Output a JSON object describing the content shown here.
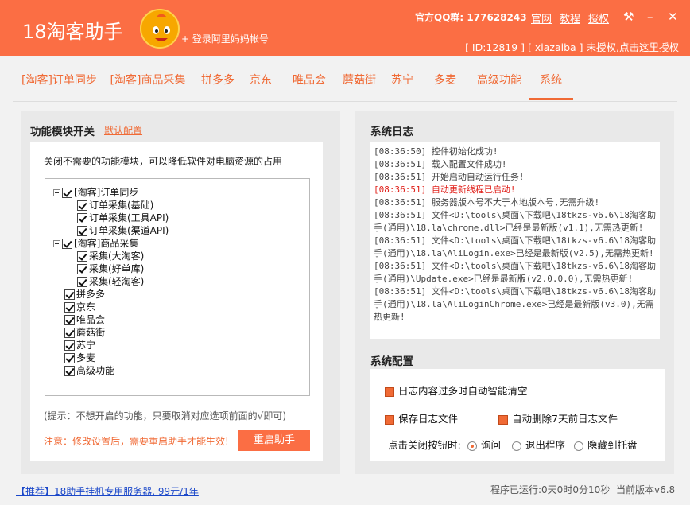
{
  "header": {
    "app_title": "18淘客助手",
    "login_link": "+ 登录阿里妈妈帐号",
    "qq_group_label": "官方QQ群:",
    "qq_group_number": "177628243",
    "links": [
      "官网",
      "教程",
      "授权"
    ],
    "user_info": "[ ID:12819 ] [ xiazaiba ] 未授权,点击这里授权",
    "colors": {
      "bar": "#fb6e44",
      "accent": "#f06a35"
    }
  },
  "tabs": [
    {
      "label": "[淘客]订单同步"
    },
    {
      "label": "[淘客]商品采集"
    },
    {
      "label": "拼多多"
    },
    {
      "label": "京东"
    },
    {
      "label": "唯品会"
    },
    {
      "label": "蘑菇街"
    },
    {
      "label": "苏宁"
    },
    {
      "label": "多麦"
    },
    {
      "label": "高级功能"
    },
    {
      "label": "系统",
      "active": true
    }
  ],
  "modules": {
    "title": "功能模块开关",
    "default_link": "默认配置",
    "description": "关闭不需要的功能模块，可以降低软件对电脑资源的占用",
    "tree": [
      {
        "label": "[淘客]订单同步",
        "level": 0,
        "expanded": true,
        "checked": true
      },
      {
        "label": "订单采集(基础)",
        "level": 1,
        "checked": true
      },
      {
        "label": "订单采集(工具API)",
        "level": 1,
        "checked": true
      },
      {
        "label": "订单采集(渠道API)",
        "level": 1,
        "checked": true
      },
      {
        "label": "[淘客]商品采集",
        "level": 0,
        "expanded": true,
        "checked": true
      },
      {
        "label": "采集(大淘客)",
        "level": 1,
        "checked": true
      },
      {
        "label": "采集(好单库)",
        "level": 1,
        "checked": true
      },
      {
        "label": "采集(轻淘客)",
        "level": 1,
        "checked": true
      },
      {
        "label": "拼多多",
        "level": 0,
        "checked": true
      },
      {
        "label": "京东",
        "level": 0,
        "checked": true
      },
      {
        "label": "唯品会",
        "level": 0,
        "checked": true
      },
      {
        "label": "蘑菇街",
        "level": 0,
        "checked": true
      },
      {
        "label": "苏宁",
        "level": 0,
        "checked": true
      },
      {
        "label": "多麦",
        "level": 0,
        "checked": true
      },
      {
        "label": "高级功能",
        "level": 0,
        "checked": true
      }
    ],
    "hint": "(提示：不想开启的功能，只要取消对应选项前面的√即可)",
    "notice": "注意：修改设置后，需要重启助手才能生效!",
    "restart_label": "重启助手"
  },
  "syslog": {
    "title": "系统日志",
    "lines": [
      {
        "text": "[08:36:50] 控件初始化成功!"
      },
      {
        "text": "[08:36:51] 载入配置文件成功!"
      },
      {
        "text": "[08:36:51] 开始启动自动运行任务!"
      },
      {
        "text": "[08:36:51] 自动更新线程已启动!",
        "error": true
      },
      {
        "text": "[08:36:51] 服务器版本号不大于本地版本号,无需升级!"
      },
      {
        "text": "[08:36:51] 文件<D:\\tools\\桌面\\下载吧\\18tkzs-v6.6\\18淘客助"
      },
      {
        "text": "手(通用)\\18.la\\chrome.dll>已经是最新版(v1.1),无需热更新!"
      },
      {
        "text": "[08:36:51] 文件<D:\\tools\\桌面\\下载吧\\18tkzs-v6.6\\18淘客助"
      },
      {
        "text": "手(通用)\\18.la\\AliLogin.exe>已经是最新版(v2.5),无需热更新!"
      },
      {
        "text": "[08:36:51] 文件<D:\\tools\\桌面\\下载吧\\18tkzs-v6.6\\18淘客助"
      },
      {
        "text": "手(通用)\\Update.exe>已经是最新版(v2.0.0.0),无需热更新!"
      },
      {
        "text": "[08:36:51] 文件<D:\\tools\\桌面\\下载吧\\18tkzs-v6.6\\18淘客助"
      },
      {
        "text": "手(通用)\\18.la\\AliLoginChrome.exe>已经是最新版(v3.0),无需"
      },
      {
        "text": "热更新!"
      }
    ]
  },
  "sysconfig": {
    "title": "系统配置",
    "auto_clear": "日志内容过多时自动智能清空",
    "save_log": "保存日志文件",
    "auto_delete": "自动删除7天前日志文件",
    "close_label": "点击关闭按钮时:",
    "close_options": [
      {
        "label": "询问",
        "selected": true
      },
      {
        "label": "退出程序",
        "selected": false
      },
      {
        "label": "隐藏到托盘",
        "selected": false
      }
    ]
  },
  "footer": {
    "ad": "【推荐】18助手挂机专用服务器, 99元/1年",
    "runtime": "程序已运行:0天0时0分10秒",
    "version": "当前版本v6.8"
  }
}
